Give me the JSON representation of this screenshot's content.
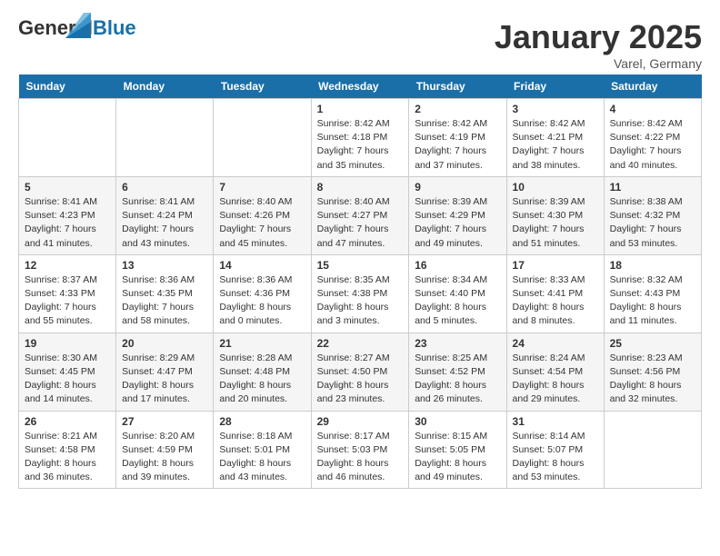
{
  "header": {
    "logo_general": "General",
    "logo_blue": "Blue",
    "month_title": "January 2025",
    "location": "Varel, Germany"
  },
  "days_of_week": [
    "Sunday",
    "Monday",
    "Tuesday",
    "Wednesday",
    "Thursday",
    "Friday",
    "Saturday"
  ],
  "weeks": [
    [
      {
        "day": "",
        "info": ""
      },
      {
        "day": "",
        "info": ""
      },
      {
        "day": "",
        "info": ""
      },
      {
        "day": "1",
        "info": "Sunrise: 8:42 AM\nSunset: 4:18 PM\nDaylight: 7 hours\nand 35 minutes."
      },
      {
        "day": "2",
        "info": "Sunrise: 8:42 AM\nSunset: 4:19 PM\nDaylight: 7 hours\nand 37 minutes."
      },
      {
        "day": "3",
        "info": "Sunrise: 8:42 AM\nSunset: 4:21 PM\nDaylight: 7 hours\nand 38 minutes."
      },
      {
        "day": "4",
        "info": "Sunrise: 8:42 AM\nSunset: 4:22 PM\nDaylight: 7 hours\nand 40 minutes."
      }
    ],
    [
      {
        "day": "5",
        "info": "Sunrise: 8:41 AM\nSunset: 4:23 PM\nDaylight: 7 hours\nand 41 minutes."
      },
      {
        "day": "6",
        "info": "Sunrise: 8:41 AM\nSunset: 4:24 PM\nDaylight: 7 hours\nand 43 minutes."
      },
      {
        "day": "7",
        "info": "Sunrise: 8:40 AM\nSunset: 4:26 PM\nDaylight: 7 hours\nand 45 minutes."
      },
      {
        "day": "8",
        "info": "Sunrise: 8:40 AM\nSunset: 4:27 PM\nDaylight: 7 hours\nand 47 minutes."
      },
      {
        "day": "9",
        "info": "Sunrise: 8:39 AM\nSunset: 4:29 PM\nDaylight: 7 hours\nand 49 minutes."
      },
      {
        "day": "10",
        "info": "Sunrise: 8:39 AM\nSunset: 4:30 PM\nDaylight: 7 hours\nand 51 minutes."
      },
      {
        "day": "11",
        "info": "Sunrise: 8:38 AM\nSunset: 4:32 PM\nDaylight: 7 hours\nand 53 minutes."
      }
    ],
    [
      {
        "day": "12",
        "info": "Sunrise: 8:37 AM\nSunset: 4:33 PM\nDaylight: 7 hours\nand 55 minutes."
      },
      {
        "day": "13",
        "info": "Sunrise: 8:36 AM\nSunset: 4:35 PM\nDaylight: 7 hours\nand 58 minutes."
      },
      {
        "day": "14",
        "info": "Sunrise: 8:36 AM\nSunset: 4:36 PM\nDaylight: 8 hours\nand 0 minutes."
      },
      {
        "day": "15",
        "info": "Sunrise: 8:35 AM\nSunset: 4:38 PM\nDaylight: 8 hours\nand 3 minutes."
      },
      {
        "day": "16",
        "info": "Sunrise: 8:34 AM\nSunset: 4:40 PM\nDaylight: 8 hours\nand 5 minutes."
      },
      {
        "day": "17",
        "info": "Sunrise: 8:33 AM\nSunset: 4:41 PM\nDaylight: 8 hours\nand 8 minutes."
      },
      {
        "day": "18",
        "info": "Sunrise: 8:32 AM\nSunset: 4:43 PM\nDaylight: 8 hours\nand 11 minutes."
      }
    ],
    [
      {
        "day": "19",
        "info": "Sunrise: 8:30 AM\nSunset: 4:45 PM\nDaylight: 8 hours\nand 14 minutes."
      },
      {
        "day": "20",
        "info": "Sunrise: 8:29 AM\nSunset: 4:47 PM\nDaylight: 8 hours\nand 17 minutes."
      },
      {
        "day": "21",
        "info": "Sunrise: 8:28 AM\nSunset: 4:48 PM\nDaylight: 8 hours\nand 20 minutes."
      },
      {
        "day": "22",
        "info": "Sunrise: 8:27 AM\nSunset: 4:50 PM\nDaylight: 8 hours\nand 23 minutes."
      },
      {
        "day": "23",
        "info": "Sunrise: 8:25 AM\nSunset: 4:52 PM\nDaylight: 8 hours\nand 26 minutes."
      },
      {
        "day": "24",
        "info": "Sunrise: 8:24 AM\nSunset: 4:54 PM\nDaylight: 8 hours\nand 29 minutes."
      },
      {
        "day": "25",
        "info": "Sunrise: 8:23 AM\nSunset: 4:56 PM\nDaylight: 8 hours\nand 32 minutes."
      }
    ],
    [
      {
        "day": "26",
        "info": "Sunrise: 8:21 AM\nSunset: 4:58 PM\nDaylight: 8 hours\nand 36 minutes."
      },
      {
        "day": "27",
        "info": "Sunrise: 8:20 AM\nSunset: 4:59 PM\nDaylight: 8 hours\nand 39 minutes."
      },
      {
        "day": "28",
        "info": "Sunrise: 8:18 AM\nSunset: 5:01 PM\nDaylight: 8 hours\nand 43 minutes."
      },
      {
        "day": "29",
        "info": "Sunrise: 8:17 AM\nSunset: 5:03 PM\nDaylight: 8 hours\nand 46 minutes."
      },
      {
        "day": "30",
        "info": "Sunrise: 8:15 AM\nSunset: 5:05 PM\nDaylight: 8 hours\nand 49 minutes."
      },
      {
        "day": "31",
        "info": "Sunrise: 8:14 AM\nSunset: 5:07 PM\nDaylight: 8 hours\nand 53 minutes."
      },
      {
        "day": "",
        "info": ""
      }
    ]
  ]
}
